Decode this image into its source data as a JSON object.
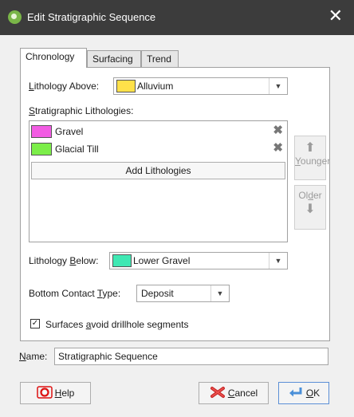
{
  "window": {
    "title": "Edit Stratigraphic Sequence",
    "close_glyph": "✕"
  },
  "tabs": [
    {
      "label": "Chronology",
      "active": true
    },
    {
      "label": "Surfacing",
      "active": false
    },
    {
      "label": "Trend",
      "active": false
    }
  ],
  "lithology_above": {
    "label_u": "L",
    "label_rest": "ithology Above:",
    "value": "Alluvium",
    "color": "#ffe14a"
  },
  "strat_lithologies": {
    "label_u": "S",
    "label_rest": "tratigraphic Lithologies:",
    "items": [
      {
        "name": "Gravel",
        "color": "#f25ce3"
      },
      {
        "name": "Glacial Till",
        "color": "#7cee49"
      }
    ],
    "add_label": "Add Lithologies"
  },
  "side_buttons": {
    "younger": {
      "label_u": "Y",
      "label_rest": "ounger"
    },
    "older": {
      "label_pre": "Ol",
      "label_u": "d",
      "label_rest": "er"
    }
  },
  "lithology_below": {
    "label_pre": "Lithology ",
    "label_u": "B",
    "label_rest": "elow:",
    "value": "Lower Gravel",
    "color": "#3fe8b3"
  },
  "bottom_contact": {
    "label_pre": "Bottom Contact ",
    "label_u": "T",
    "label_rest": "ype:",
    "value": "Deposit"
  },
  "surfaces_avoid": {
    "label_pre": "Surfaces ",
    "label_u": "a",
    "label_rest": "void drillhole segments",
    "checked": true,
    "check_glyph": "✓"
  },
  "name": {
    "label_u": "N",
    "label_rest": "ame:",
    "value": "Stratigraphic Sequence"
  },
  "buttons": {
    "help": {
      "label_u": "H",
      "label_rest": "elp"
    },
    "cancel": {
      "label_u": "C",
      "label_rest": "ancel"
    },
    "ok": {
      "label_u": "O",
      "label_rest": "K"
    }
  },
  "icons": {
    "delete": "✖",
    "up": "⬆",
    "down": "⬇",
    "dropdown": "▼"
  }
}
